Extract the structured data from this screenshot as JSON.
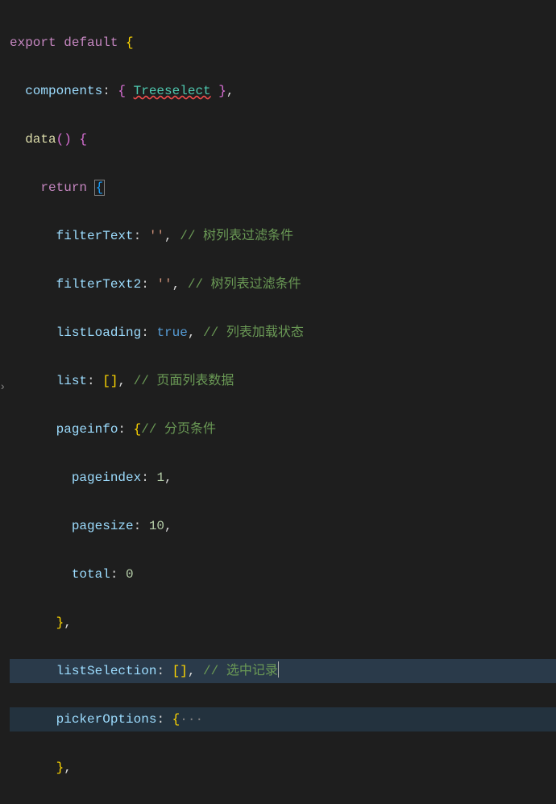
{
  "code": {
    "l1_export": "export",
    "l1_default": "default",
    "l1_brace": " {",
    "l2_indent": "  ",
    "l2_prop": "components",
    "l2_colon": ": ",
    "l2_open": "{ ",
    "l2_ident": "Treeselect",
    "l2_close": " }",
    "l2_comma": ",",
    "l3_indent": "  ",
    "l3_func": "data",
    "l3_paren": "()",
    "l3_brace": " {",
    "l4_indent": "    ",
    "l4_return": "return",
    "l4_space": " ",
    "l4_brace": "{",
    "l5_indent": "      ",
    "l5_prop": "filterText",
    "l5_colon": ": ",
    "l5_str": "''",
    "l5_comma": ", ",
    "l5_comment": "// 树列表过滤条件",
    "l6_indent": "      ",
    "l6_prop": "filterText2",
    "l6_colon": ": ",
    "l6_str": "''",
    "l6_comma": ", ",
    "l6_comment": "// 树列表过滤条件",
    "l7_indent": "      ",
    "l7_prop": "listLoading",
    "l7_colon": ": ",
    "l7_val": "true",
    "l7_comma": ", ",
    "l7_comment": "// 列表加载状态",
    "l8_indent": "      ",
    "l8_prop": "list",
    "l8_colon": ": ",
    "l8_arr": "[]",
    "l8_comma": ", ",
    "l8_comment": "// 页面列表数据",
    "l9_indent": "      ",
    "l9_prop": "pageinfo",
    "l9_colon": ": ",
    "l9_brace": "{",
    "l9_comment": "// 分页条件",
    "l10_indent": "        ",
    "l10_prop": "pageindex",
    "l10_colon": ": ",
    "l10_val": "1",
    "l10_comma": ",",
    "l11_indent": "        ",
    "l11_prop": "pagesize",
    "l11_colon": ": ",
    "l11_val": "10",
    "l11_comma": ",",
    "l12_indent": "        ",
    "l12_prop": "total",
    "l12_colon": ": ",
    "l12_val": "0",
    "l13_indent": "      ",
    "l13_brace": "}",
    "l13_comma": ",",
    "l14_indent": "      ",
    "l14_prop": "listSelection",
    "l14_colon": ": ",
    "l14_arr": "[]",
    "l14_comma": ", ",
    "l14_comment": "// 选中记录",
    "l15_indent": "      ",
    "l15_prop": "pickerOptions",
    "l15_colon": ": ",
    "l15_brace": "{",
    "l15_fold": "···",
    "l16_indent": "      ",
    "l16_brace": "}",
    "l16_comma": ","
  }
}
